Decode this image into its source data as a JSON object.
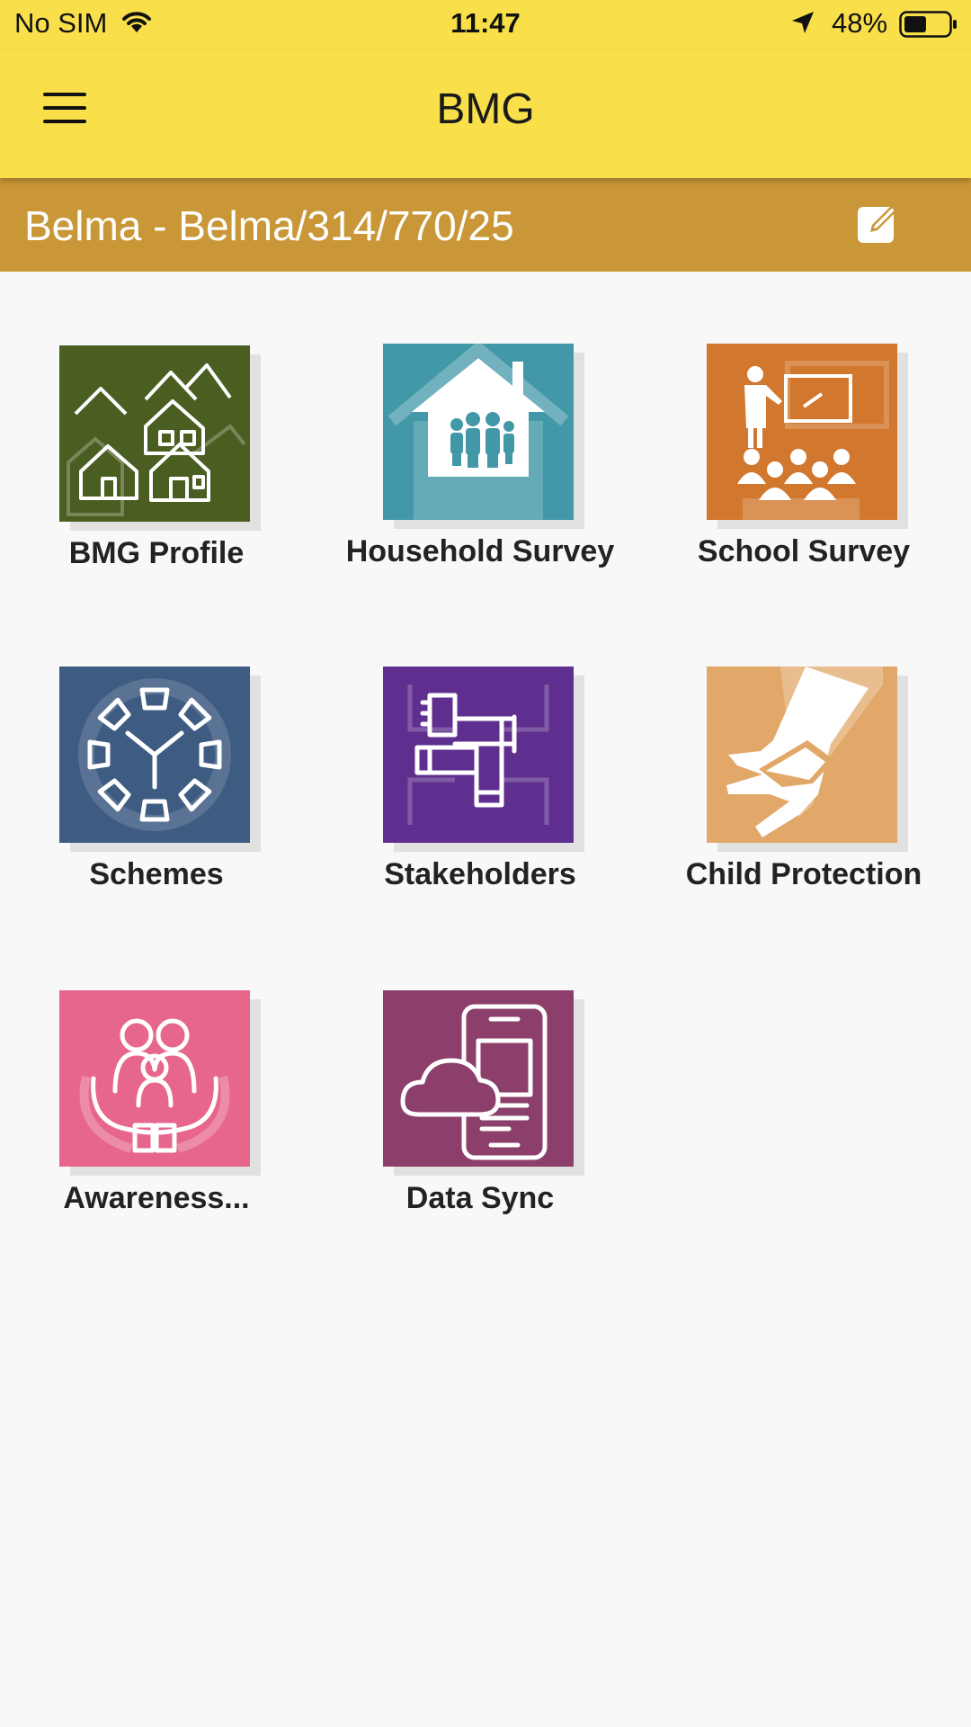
{
  "status_bar": {
    "carrier": "No SIM",
    "time": "11:47",
    "battery": "48%"
  },
  "app_bar": {
    "title": "BMG"
  },
  "sub_header": {
    "code": "Belma - Belma/314/770/25"
  },
  "tiles": [
    {
      "label": "BMG Profile",
      "color": "#4b5e22",
      "icon": "village-houses-icon"
    },
    {
      "label": "Household Survey",
      "color": "#4398a8",
      "icon": "house-family-icon"
    },
    {
      "label": "School Survey",
      "color": "#d2772e",
      "icon": "classroom-teacher-icon"
    },
    {
      "label": "Schemes",
      "color": "#3e5b82",
      "icon": "segmented-wheel-icon"
    },
    {
      "label": "Stakeholders",
      "color": "#5e2f8e",
      "icon": "joined-hands-icon"
    },
    {
      "label": "Child Protection",
      "color": "#e2a86a",
      "icon": "hand-in-hand-icon"
    },
    {
      "label": "Awareness...",
      "color": "#e6668c",
      "icon": "family-care-hands-icon"
    },
    {
      "label": "Data Sync",
      "color": "#8b3f6a",
      "icon": "cloud-phone-sync-icon"
    }
  ]
}
